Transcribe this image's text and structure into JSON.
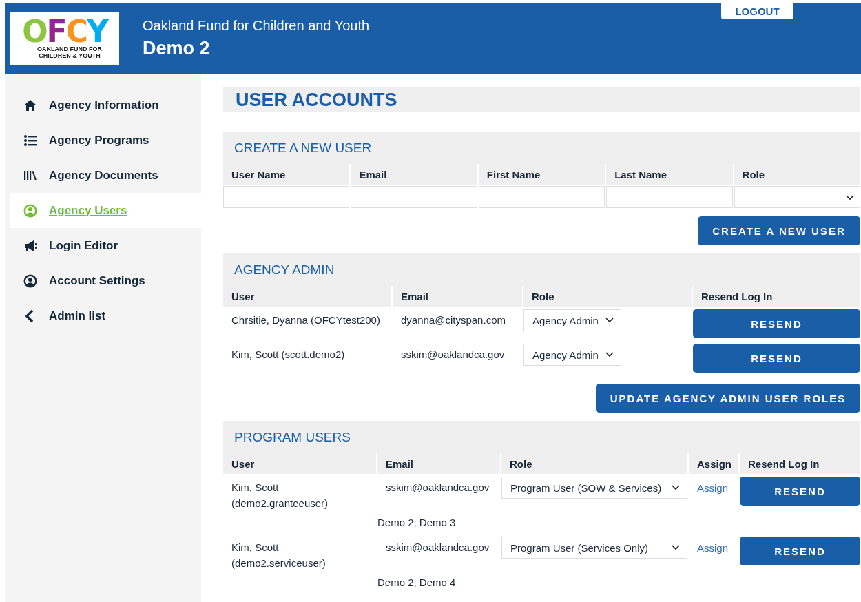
{
  "header": {
    "logo": {
      "letters": [
        {
          "text": "O",
          "color": "#8cc63f"
        },
        {
          "text": "F",
          "color": "#92278f"
        },
        {
          "text": "C",
          "color": "#f7941d"
        },
        {
          "text": "Y",
          "color": "#00aeef"
        }
      ],
      "tagline": [
        "OAKLAND FUND FOR",
        "CHILDREN & YOUTH"
      ]
    },
    "org": "Oakland Fund for Children and Youth",
    "title": "Demo 2",
    "logout": "LOGOUT"
  },
  "sidebar": [
    {
      "label": "Agency Information",
      "selected": false
    },
    {
      "label": "Agency Programs",
      "selected": false
    },
    {
      "label": "Agency Documents",
      "selected": false
    },
    {
      "label": "Agency Users",
      "selected": true
    },
    {
      "label": "Login Editor",
      "selected": false
    },
    {
      "label": "Account Settings",
      "selected": false
    },
    {
      "label": "Admin list",
      "selected": false
    }
  ],
  "page_title": "USER ACCOUNTS",
  "create": {
    "title": "CREATE A NEW USER",
    "columns": [
      "User Name",
      "Email",
      "First Name",
      "Last Name",
      "Role"
    ],
    "button": "CREATE A NEW USER"
  },
  "admin": {
    "title": "AGENCY ADMIN",
    "columns": [
      "User",
      "Email",
      "Role",
      "Resend Log In"
    ],
    "rows": [
      {
        "user": "Chrsitie, Dyanna (OFCYtest200)",
        "email": "dyanna@cityspan.com",
        "role": "Agency Admin",
        "button": "RESEND"
      },
      {
        "user": "Kim, Scott (scott.demo2)",
        "email": "sskim@oaklandca.gov",
        "role": "Agency Admin",
        "button": "RESEND"
      }
    ],
    "button": "UPDATE AGENCY ADMIN USER ROLES"
  },
  "program": {
    "title": "PROGRAM USERS",
    "columns": [
      "User",
      "Email",
      "Role",
      "Assign",
      "Resend Log In"
    ],
    "rows": [
      {
        "user": "Kim, Scott (demo2.granteeuser)",
        "email": "sskim@oaklandca.gov",
        "role": "Program User (SOW & Services)",
        "assign": "Assign",
        "button": "RESEND",
        "programs": "Demo 2; Demo 3"
      },
      {
        "user": "Kim, Scott (demo2.serviceuser)",
        "email": "sskim@oaklandca.gov",
        "role": "Program User (Services Only)",
        "assign": "Assign",
        "button": "RESEND",
        "programs": "Demo 2; Demo 4"
      }
    ]
  }
}
